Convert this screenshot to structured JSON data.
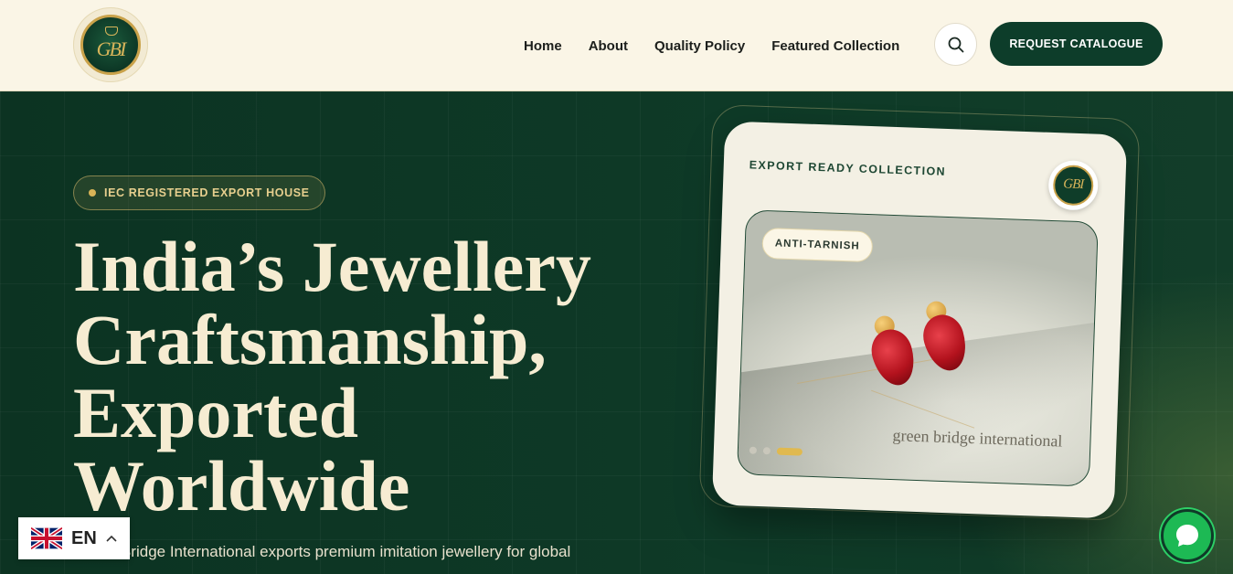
{
  "header": {
    "logo_text": "GBI",
    "nav": [
      "Home",
      "About",
      "Quality Policy",
      "Featured Collection"
    ],
    "search_icon": "search-icon",
    "cta_label": "REQUEST CATALOGUE"
  },
  "hero": {
    "badge": "IEC REGISTERED EXPORT HOUSE",
    "headline_lines": [
      "India’s Jewellery",
      "Craftsmanship,",
      "Exported",
      "Worldwide"
    ],
    "subtext": "Green Bridge International exports premium imitation jewellery for global"
  },
  "card": {
    "title": "EXPORT READY COLLECTION",
    "logo_text": "GBI",
    "tag": "ANTI-TARNISH",
    "photo_caption": "green bridge international",
    "slides_total": 3,
    "slide_active": 3
  },
  "language": {
    "code": "EN",
    "flag": "uk-flag-icon"
  },
  "chat": {
    "icon": "chat-bubble-icon"
  },
  "colors": {
    "brand_green": "#0d3d2a",
    "cream": "#faf5e6",
    "gold": "#d9b457"
  }
}
